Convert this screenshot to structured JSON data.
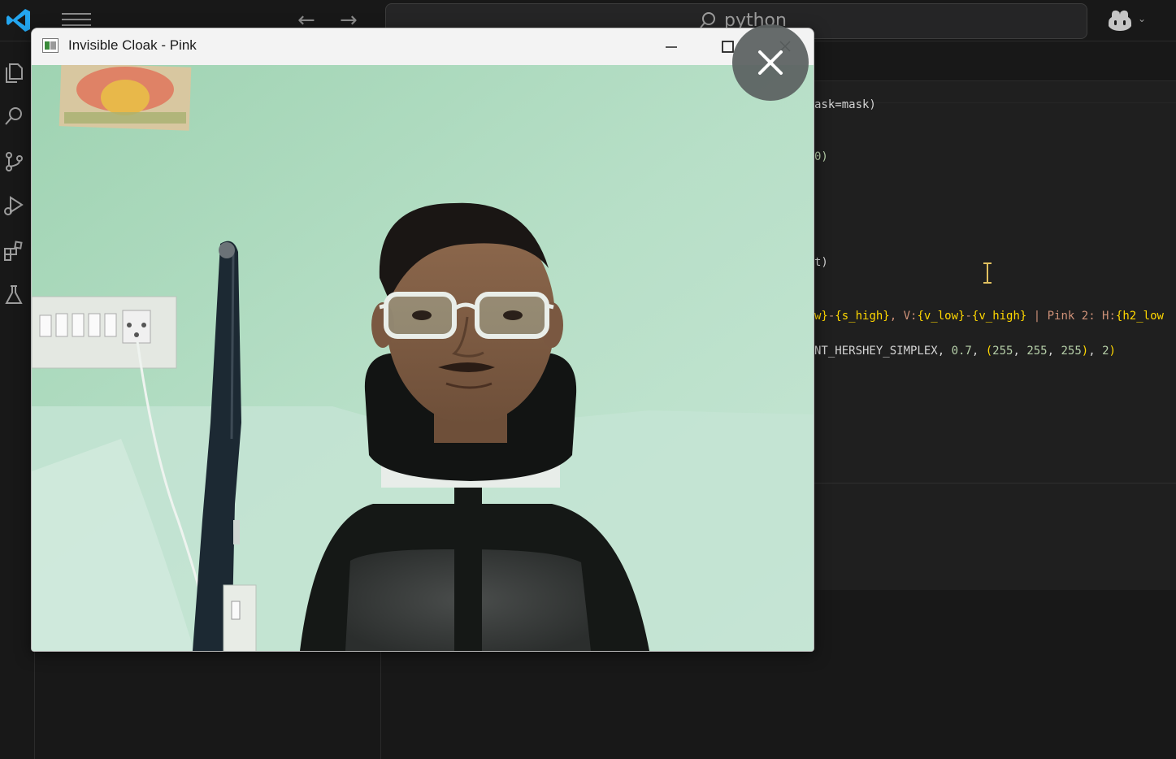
{
  "titlebar": {
    "search_text": "python",
    "icons": [
      "vscode-logo",
      "menu-icon",
      "back-arrow-icon",
      "forward-arrow-icon",
      "search-icon",
      "copilot-icon",
      "chevron-down-icon"
    ],
    "back_glyph": "←",
    "forward_glyph": "→",
    "chevron_glyph": "⌄"
  },
  "activitybar": {
    "items": [
      "explorer-icon",
      "search-icon",
      "source-control-icon",
      "run-debug-icon",
      "extensions-icon",
      "testing-icon"
    ]
  },
  "editor": {
    "lines": [
      {
        "segments": [
          {
            "t": "ask=mask)",
            "c": "c-white"
          }
        ]
      },
      {
        "segments": [
          {
            "t": "0)",
            "c": "c-num"
          }
        ]
      },
      {
        "segments": [
          {
            "t": "t)",
            "c": "c-white"
          }
        ]
      },
      {
        "segments": [
          {
            "t": "w}",
            "c": "brace"
          },
          {
            "t": "-",
            "c": "c-orange"
          },
          {
            "t": "{s_high}",
            "c": "brace"
          },
          {
            "t": ", V:",
            "c": "c-orange"
          },
          {
            "t": "{v_low}",
            "c": "brace"
          },
          {
            "t": "-",
            "c": "c-orange"
          },
          {
            "t": "{v_high}",
            "c": "brace"
          },
          {
            "t": " | Pink 2: H:",
            "c": "c-orange"
          },
          {
            "t": "{h2_low",
            "c": "brace"
          }
        ]
      },
      {
        "segments": [
          {
            "t": "NT_HERSHEY_SIMPLEX, ",
            "c": "c-white"
          },
          {
            "t": "0.7",
            "c": "c-num"
          },
          {
            "t": ", ",
            "c": "c-white"
          },
          {
            "t": "(",
            "c": "brace"
          },
          {
            "t": "255",
            "c": "c-num"
          },
          {
            "t": ", ",
            "c": "c-white"
          },
          {
            "t": "255",
            "c": "c-num"
          },
          {
            "t": ", ",
            "c": "c-white"
          },
          {
            "t": "255",
            "c": "c-num"
          },
          {
            "t": ")",
            "c": "brace"
          },
          {
            "t": ", ",
            "c": "c-white"
          },
          {
            "t": "2",
            "c": "c-num"
          },
          {
            "t": ")",
            "c": "brace"
          }
        ]
      }
    ]
  },
  "cv_window": {
    "title": "Invisible Cloak - Pink",
    "buttons": [
      "minimize-button",
      "maximize-button",
      "close-button"
    ]
  },
  "overlay": {
    "close_icon": "close-icon"
  },
  "colors": {
    "editor_bg": "#1f1f1f",
    "chrome_bg": "#181818",
    "vscode_blue": "#23a6f0",
    "wall_green": "#b8dcc4",
    "chair_black": "#151816"
  }
}
